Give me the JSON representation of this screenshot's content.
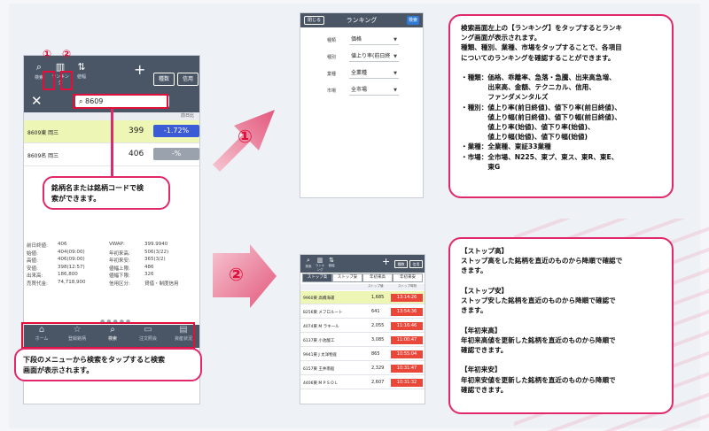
{
  "phone1": {
    "top_icons": [
      {
        "badge": "①",
        "icon": "search-icon",
        "label": "検索"
      },
      {
        "badge": "",
        "icon": "ranking-icon",
        "label": "ランキング"
      },
      {
        "badge": "②",
        "icon": "stop-icon",
        "label": "値幅"
      }
    ],
    "header_buttons": [
      "種数",
      "信用"
    ],
    "search_value": "8609",
    "column_header": "前日比",
    "rows": [
      {
        "name": "8609東 岡三",
        "price": "399",
        "change": "-1.72%",
        "change_color": "#3b5bd6",
        "highlight": true
      },
      {
        "name": "8609名 岡三",
        "price": "406",
        "change": "-%",
        "change_color": "#9aa3ad",
        "highlight": false
      }
    ],
    "stats": [
      [
        "前日終値:",
        "406",
        "VWAP:",
        "399.9940"
      ],
      [
        "始値:",
        "404(09:00)",
        "年初来高:",
        "506(3/22)"
      ],
      [
        "高値:",
        "406(09:00)",
        "年初来安:",
        "365(3/2)"
      ],
      [
        "安値:",
        "398(12:57)",
        "値幅上限:",
        "486"
      ],
      [
        "出来高:",
        "186,800",
        "値幅下限:",
        "326"
      ],
      [
        "売買代金:",
        "74,718,900",
        "信用区分:",
        "貸借・制度信用"
      ]
    ],
    "tabs": [
      {
        "icon": "home-icon",
        "label": "ホーム"
      },
      {
        "icon": "star-icon",
        "label": "登録銘柄"
      },
      {
        "icon": "search-icon",
        "label": "検索"
      },
      {
        "icon": "order-icon",
        "label": "注文照会"
      },
      {
        "icon": "asset-icon",
        "label": "資産状況"
      }
    ]
  },
  "callouts": {
    "search_hint": "銘柄名または銘柄コードで検\n索ができます。",
    "menu_hint": "下段のメニューから検索をタップすると検索\n画面が表示されます。"
  },
  "arrows": {
    "step1": "①",
    "step2": "②"
  },
  "phone2": {
    "back": "閉じる",
    "title": "ランキング",
    "search": "検索",
    "rows": [
      {
        "label": "種類",
        "value": "価格"
      },
      {
        "label": "種別",
        "value": "値上り率(前日終"
      },
      {
        "label": "業種",
        "value": "全業種"
      },
      {
        "label": "市場",
        "value": "全市場"
      }
    ]
  },
  "phone3": {
    "icons": [
      {
        "glyph": "⌕",
        "label": "検索"
      },
      {
        "glyph": "▥",
        "label": "ランキング"
      },
      {
        "glyph": "⇅",
        "label": "値幅"
      }
    ],
    "header_buttons": [
      "種数",
      "信用"
    ],
    "tabs": [
      "ストップ高",
      "ストップ安",
      "年初来高",
      "年初来安"
    ],
    "col_price": "ストップ値",
    "col_time": "ストップ時刻",
    "rows": [
      {
        "name": "9960東 高橋海運",
        "price": "1,685",
        "time": "13:14:26"
      },
      {
        "name": "8256東 メフロルート",
        "price": "641",
        "time": "13:54:36"
      },
      {
        "name": "4074東 M ラキール",
        "price": "2,055",
        "time": "11:16:46"
      },
      {
        "name": "6137東 小池酸工",
        "price": "3,085",
        "time": "11:00:47"
      },
      {
        "name": "9941東 J 太洋物産",
        "price": "865",
        "time": "10:55:04"
      },
      {
        "name": "6157東 王井南船",
        "price": "2,329",
        "time": "10:31:47"
      },
      {
        "name": "4406東 M P S O L",
        "price": "2,607",
        "time": "10:31:32"
      }
    ]
  },
  "info_ranking": "検索画面左上の【ランキング】をタップするとランキ\nング画面が表示されます。\n種類、種別、業種、市場をタップすることで、各項目\nについてのランキングを確認することができます。\n\n・種類：価格、乖離率、急落・急騰、出来高急増、\n　　　　出来高、金額、テクニカル、信用、\n　　　　ファンダメンタルズ\n・種別：値上り率(前日終値)、値下り率(前日終値)、\n　　　　値上り幅(前日終値)、値下り幅(前日終値)、\n　　　　値上り率(始値)、値下り率(始値)、\n　　　　値上り幅(始値)、値下り幅(始値)\n・業種：全業種、東証33業種\n・市場：全市場、N225、東プ、東ス、東R、東E、\n　　　　東G",
  "info_stop": "【ストップ高】\nストップ高をした銘柄を直近のものから降順で確認で\nきます。\n\n【ストップ安】\nストップ安した銘柄を直近のものから降順で確認で\nきます。\n\n【年初来高】\n年初来高値を更新した銘柄を直近のものから降順で\n確認できます。\n\n【年初来安】\n年初来安値を更新した銘柄を直近のものから降順で\n確認できます。"
}
